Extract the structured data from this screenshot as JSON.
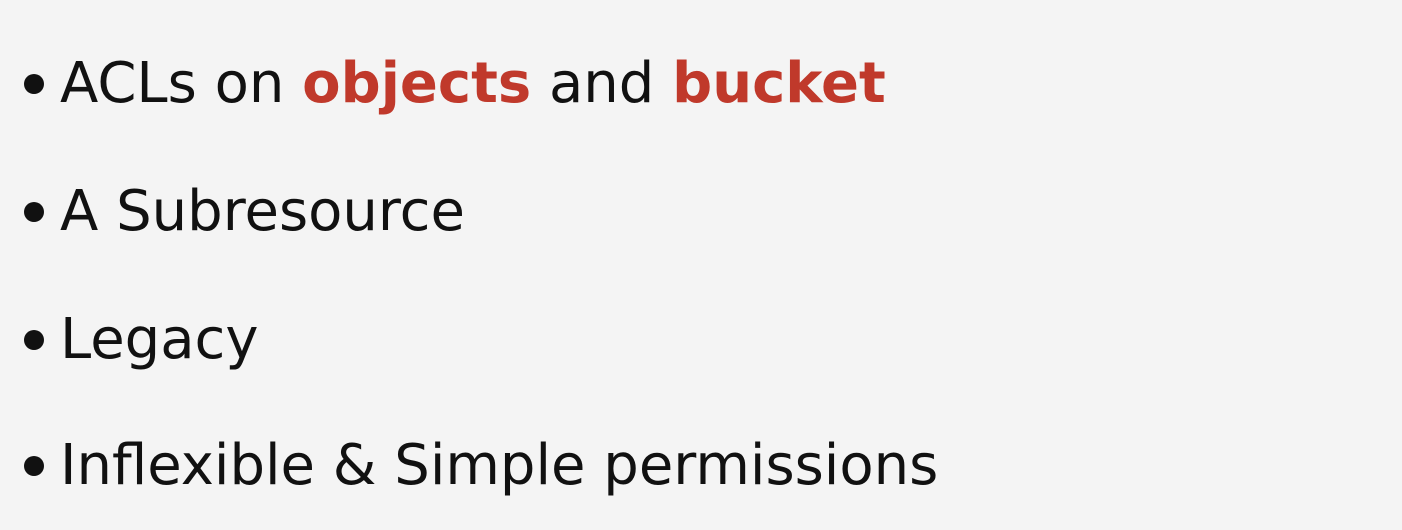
{
  "colors": {
    "background": "#f4f4f4",
    "text": "#111111",
    "highlight": "#c0392b"
  },
  "bullets": [
    {
      "part1": "ACLs on ",
      "highlight1": "objects",
      "part2": " and ",
      "highlight2": "bucket"
    },
    {
      "text": "A Subresource"
    },
    {
      "text": "Legacy"
    },
    {
      "text": "Inflexible & Simple permissions"
    }
  ]
}
